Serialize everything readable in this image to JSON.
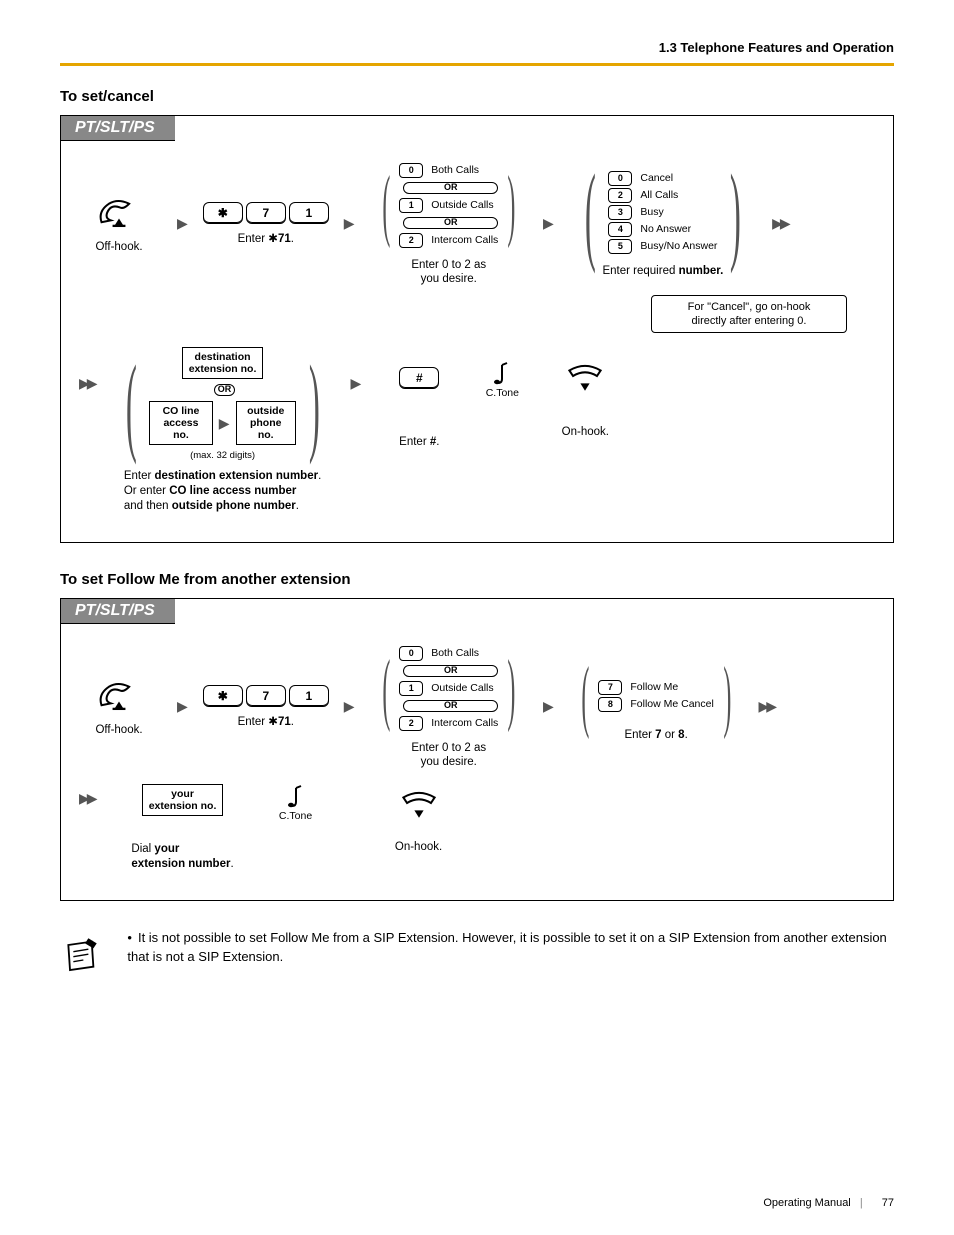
{
  "header": {
    "section_label": "1.3 Telephone Features and Operation"
  },
  "section1": {
    "title": "To set/cancel",
    "tab": "PT/SLT/PS",
    "off_hook": "Off-hook.",
    "enter71_prefix": "Enter ",
    "enter71_num": "71",
    "enter71_suffix": ".",
    "group1": {
      "opt0": "Both Calls",
      "opt1": "Outside Calls",
      "opt2": "Intercom Calls",
      "caption_line1": "Enter 0 to 2 as",
      "caption_line2": "you desire."
    },
    "group2": {
      "opt0": "Cancel",
      "opt2": "All Calls",
      "opt3": "Busy",
      "opt4": "No Answer",
      "opt5": "Busy/No Answer",
      "caption_line1": "Enter required",
      "caption_line2": "number."
    },
    "cancel_note_line1": "For \"Cancel\", go on-hook",
    "cancel_note_line2": "directly after entering 0.",
    "row2": {
      "dest_ext": "destination\nextension no.",
      "co_line": "CO line\naccess no.",
      "outside_phone": "outside\nphone no.",
      "max_digits": "(max. 32 digits)",
      "caption_l1": "Enter destination extension number.",
      "caption_l2": "Or enter CO line access number",
      "caption_l3": "and then outside phone number.",
      "hash_caption": "Enter #.",
      "ctone": "C.Tone",
      "on_hook": "On-hook."
    },
    "or_label": "OR"
  },
  "section2": {
    "title": "To set Follow Me from another extension",
    "tab": "PT/SLT/PS",
    "off_hook": "Off-hook.",
    "enter71_prefix": "Enter ",
    "enter71_num": "71",
    "enter71_suffix": ".",
    "group1": {
      "opt0": "Both Calls",
      "opt1": "Outside Calls",
      "opt2": "Intercom Calls",
      "caption_line1": "Enter 0 to 2 as",
      "caption_line2": "you desire."
    },
    "group2": {
      "opt7": "Follow Me",
      "opt8": "Follow Me Cancel",
      "caption": "Enter 7 or 8."
    },
    "row2": {
      "your_ext": "your\nextension no.",
      "ctone": "C.Tone",
      "caption_l1": "Dial your",
      "caption_l2": "extension number.",
      "on_hook": "On-hook."
    }
  },
  "note": {
    "text": "It is not possible to set Follow Me from a SIP Extension. However, it is possible to set it on a SIP Extension from another extension that is not a SIP Extension."
  },
  "footer": {
    "manual": "Operating Manual",
    "page": "77"
  },
  "keys": {
    "star": "✱",
    "k7": "7",
    "k1": "1",
    "hash": "#",
    "k0": "0",
    "k2": "2",
    "k3": "3",
    "k4": "4",
    "k5": "5",
    "k8": "8"
  }
}
